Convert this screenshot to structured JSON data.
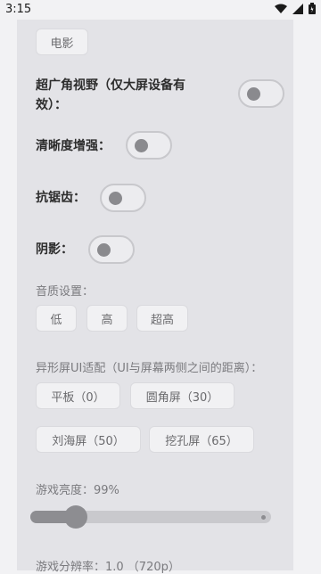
{
  "status": {
    "time": "3:15"
  },
  "buttons": {
    "movie": "电影",
    "low": "低",
    "high": "高",
    "ultra": "超高",
    "flat": "平板（0）",
    "round": "圆角屏（30）",
    "notch": "刘海屏（50）",
    "hole": "挖孔屏（65）"
  },
  "settings": {
    "wide_fov": "超广角视野（仅大屏设备有效）：",
    "sharpness": "清晰度增强：",
    "antialias": "抗锯齿：",
    "shadow": "阴影："
  },
  "sections": {
    "audio_quality": "音质设置：",
    "notch_adapt": "异形屏UI适配（UI与屏幕两侧之间的距离）：",
    "brightness": "游戏亮度：99%",
    "resolution": "游戏分辨率：1.0 （720p）"
  },
  "brightness_level": 0.99
}
